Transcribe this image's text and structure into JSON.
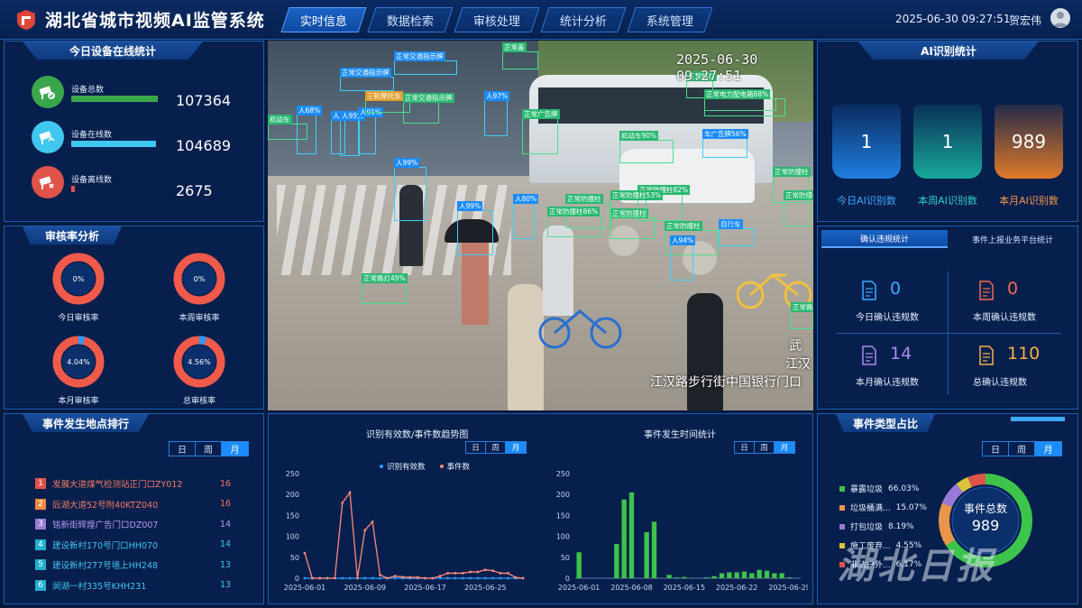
{
  "header": {
    "title": "湖北省城市视频AI监管系统",
    "tabs": [
      "实时信息",
      "数据检索",
      "审核处理",
      "统计分析",
      "系统管理"
    ],
    "active_tab": 0,
    "datetime": "2025-06-30 09:27:51",
    "user": "贺宏伟"
  },
  "device_panel": {
    "title": "今日设备在线统计",
    "items": [
      {
        "label": "设备总数",
        "value": "107364",
        "color": "#3aa64b",
        "bar_fraction": 1.0
      },
      {
        "label": "设备在线数",
        "value": "104689",
        "color": "#3fc7f0",
        "bar_fraction": 0.975
      },
      {
        "label": "设备离线数",
        "value": "2675",
        "color": "#e0534a",
        "bar_fraction": 0.025
      }
    ]
  },
  "audit_panel": {
    "title": "审核率分析",
    "items": [
      {
        "label": "今日审核率",
        "value": "0%",
        "fraction": 0
      },
      {
        "label": "本周审核率",
        "value": "0%",
        "fraction": 0
      },
      {
        "label": "本月审核率",
        "value": "4.04%",
        "fraction": 0.0404
      },
      {
        "label": "总审核率",
        "value": "4.56%",
        "fraction": 0.0456
      }
    ]
  },
  "video": {
    "timestamp": "2025-06-30 09:27:51",
    "location": "江汉路步行街中国银行门口",
    "side_text": [
      "武",
      "江汉"
    ],
    "detections": [
      "人99%",
      "人97%",
      "人95%",
      "人91%",
      "人68%",
      "人80%",
      "人99%",
      "人94%",
      "人97%",
      "正常交通指示牌",
      "正常交通指示牌",
      "正常电力配电箱",
      "正常路灯",
      "正常防撞柱",
      "正常防撞柱82%",
      "正常防撞柱86%",
      "正常防撞柱",
      "正常防撞柱53%",
      "正常防撞柱",
      "正常防撞柱",
      "正常路灯49%",
      "三轮摩托车",
      "机动车",
      "机动车90%",
      "车广告牌56%",
      "正常广告牌",
      "正常交通指示牌",
      "正常防撞柱",
      "自行车",
      "正常路牌",
      "正常电力配电箱88%",
      "正常盖"
    ]
  },
  "ai_panel": {
    "title": "AI识别统计",
    "items": [
      {
        "label": "今日AI识别数",
        "value": "1",
        "color": "#1e7fe0",
        "label_color": "#3fa9ff"
      },
      {
        "label": "本周AI识别数",
        "value": "1",
        "color": "#18a89a",
        "label_color": "#2fd0c0"
      },
      {
        "label": "本月AI识别数",
        "value": "989",
        "color": "#e07a2a",
        "label_color": "#f29a4a"
      }
    ]
  },
  "violation_panel": {
    "tabs": [
      "确认违规统计",
      "事件上报业务平台统计"
    ],
    "items": [
      {
        "label": "今日确认违规数",
        "value": "0",
        "color": "#3fa9ff"
      },
      {
        "label": "本周确认违规数",
        "value": "0",
        "color": "#f06a50"
      },
      {
        "label": "本月确认违规数",
        "value": "14",
        "color": "#a98bf0"
      },
      {
        "label": "总确认违规数",
        "value": "110",
        "color": "#f2b24a"
      }
    ]
  },
  "ranking_panel": {
    "title": "事件发生地点排行",
    "toggle": [
      "日",
      "周",
      "月"
    ],
    "items": [
      {
        "rank": "1",
        "name": "发展大道煤气检测站正门口ZY012",
        "count": "16",
        "color": "#e0534a"
      },
      {
        "rank": "2",
        "name": "后湖大道52号附40KTZ040",
        "count": "16",
        "color": "#f08a40"
      },
      {
        "rank": "3",
        "name": "铭新街辉煌广告门口DZ007",
        "count": "14",
        "color": "#9a7ad8"
      },
      {
        "rank": "4",
        "name": "建设新村170号门口HH070",
        "count": "14",
        "color": "#22b0d0"
      },
      {
        "rank": "5",
        "name": "建设新村277号墙上HH248",
        "count": "13",
        "color": "#22b0d0"
      },
      {
        "rank": "6",
        "name": "涧湖一村335号KHH231",
        "count": "13",
        "color": "#22b0d0"
      }
    ]
  },
  "trend_panel": {
    "toggle": [
      "日",
      "周",
      "月"
    ],
    "toggle2": [
      "日",
      "周",
      "月"
    ]
  },
  "chart_data": [
    {
      "type": "line",
      "title": "识别有效数/事件数趋势图",
      "ylim": [
        0,
        250
      ],
      "yticks": [
        0,
        50,
        100,
        150,
        200,
        250
      ],
      "xtick_labels": [
        "2025-06-01",
        "2025-06-09",
        "2025-06-17",
        "2025-06-25"
      ],
      "xtick_index": [
        0,
        8,
        16,
        24
      ],
      "x": [
        "06-01",
        "06-02",
        "06-03",
        "06-04",
        "06-05",
        "06-06",
        "06-07",
        "06-08",
        "06-09",
        "06-10",
        "06-11",
        "06-12",
        "06-13",
        "06-14",
        "06-15",
        "06-16",
        "06-17",
        "06-18",
        "06-19",
        "06-20",
        "06-21",
        "06-22",
        "06-23",
        "06-24",
        "06-25",
        "06-26",
        "06-27",
        "06-28",
        "06-29",
        "06-30"
      ],
      "series": [
        {
          "name": "识别有效数",
          "color": "#2a9cff",
          "values": [
            0,
            0,
            0,
            0,
            0,
            0,
            0,
            0,
            0,
            0,
            0,
            0,
            0,
            0,
            0,
            0,
            0,
            0,
            0,
            0,
            0,
            0,
            0,
            0,
            0,
            0,
            0,
            0,
            0,
            0
          ]
        },
        {
          "name": "事件数",
          "color": "#ff8a7a",
          "values": [
            60,
            0,
            0,
            0,
            0,
            180,
            205,
            0,
            115,
            135,
            8,
            0,
            5,
            3,
            2,
            2,
            0,
            0,
            5,
            12,
            12,
            12,
            15,
            15,
            20,
            18,
            12,
            12,
            2,
            0
          ]
        }
      ]
    },
    {
      "type": "bar",
      "title": "事件发生时间统计",
      "ylim": [
        0,
        250
      ],
      "yticks": [
        0,
        50,
        100,
        150,
        200,
        250
      ],
      "xtick_labels": [
        "2025-06-01",
        "2025-06-08",
        "2025-06-15",
        "2025-06-22",
        "2025-06-29"
      ],
      "xtick_index": [
        0,
        7,
        14,
        21,
        28
      ],
      "color": "#3dc44a",
      "values": [
        62,
        0,
        0,
        0,
        0,
        82,
        188,
        205,
        0,
        110,
        135,
        0,
        8,
        2,
        3,
        1,
        0,
        2,
        5,
        12,
        14,
        14,
        16,
        12,
        20,
        18,
        12,
        12,
        2,
        0
      ]
    },
    {
      "type": "pie",
      "title": "事件类型占比",
      "center_label": "事件总数",
      "center_value": "989",
      "slices": [
        {
          "name": "暴露垃圾",
          "pct": "66.03%",
          "value": 66.03,
          "color": "#3dc44a"
        },
        {
          "name": "垃圾桶满...",
          "pct": "15.07%",
          "value": 15.07,
          "color": "#e9964a"
        },
        {
          "name": "打包垃圾",
          "pct": "8.19%",
          "value": 8.19,
          "color": "#9a7ad8"
        },
        {
          "name": "施工废弃...",
          "pct": "4.55%",
          "value": 4.55,
          "color": "#d8c43a"
        },
        {
          "name": "非法户外...",
          "pct": "6.17%",
          "value": 6.17,
          "color": "#e0534a"
        }
      ]
    }
  ],
  "pie_panel": {
    "toggle": [
      "日",
      "周",
      "月"
    ]
  },
  "watermark": "湖北日报"
}
